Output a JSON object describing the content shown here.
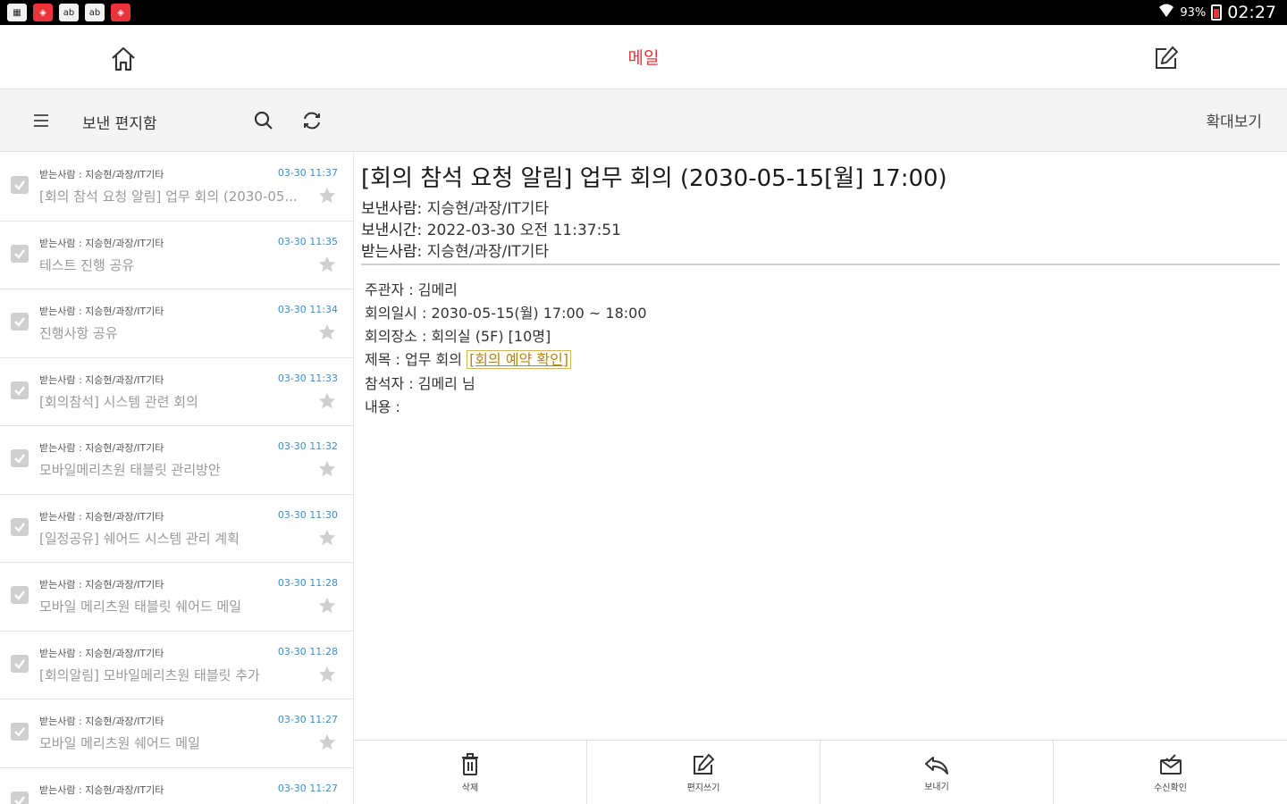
{
  "status_bar": {
    "left_icons": [
      "app-icon",
      "shield-red-icon",
      "ab-icon",
      "ab-icon",
      "shield-red-icon"
    ],
    "battery_percent": "93%",
    "time": "02:27"
  },
  "app_bar": {
    "title": "메일"
  },
  "toolbar": {
    "folder_name": "보낸 편지함",
    "zoom_label": "확대보기"
  },
  "mail_list": [
    {
      "sender": "받는사람 : 지승현/과장/IT기타",
      "date": "03-30 11:37",
      "subject": "[회의 참석 요청 알림] 업무 회의 (2030-05..."
    },
    {
      "sender": "받는사람 : 지승현/과장/IT기타",
      "date": "03-30 11:35",
      "subject": "테스트 진행 공유"
    },
    {
      "sender": "받는사람 : 지승현/과장/IT기타",
      "date": "03-30 11:34",
      "subject": "진행사항 공유"
    },
    {
      "sender": "받는사람 : 지승현/과장/IT기타",
      "date": "03-30 11:33",
      "subject": "[회의참석] 시스템 관련 회의"
    },
    {
      "sender": "받는사람 : 지승현/과장/IT기타",
      "date": "03-30 11:32",
      "subject": "모바일메리츠원 태블릿 관리방안"
    },
    {
      "sender": "받는사람 : 지승현/과장/IT기타",
      "date": "03-30 11:30",
      "subject": "[일정공유] 쉐어드 시스템 관리 계획"
    },
    {
      "sender": "받는사람 : 지승현/과장/IT기타",
      "date": "03-30 11:28",
      "subject": "모바일 메리츠원 태블릿 쉐어드 메일"
    },
    {
      "sender": "받는사람 : 지승현/과장/IT기타",
      "date": "03-30 11:28",
      "subject": "[회의알림] 모바일메리츠원 태블릿 추가"
    },
    {
      "sender": "받는사람 : 지승현/과장/IT기타",
      "date": "03-30 11:27",
      "subject": "모바일 메리츠원 쉐어드 메일"
    },
    {
      "sender": "받는사람 : 지승현/과장/IT기타",
      "date": "03-30 11:27",
      "subject": ""
    }
  ],
  "detail": {
    "subject": "[회의 참석 요청 알림] 업무 회의 (2030-05-15[월] 17:00)",
    "sender_label": "보낸사람:",
    "sender": "지승현/과장/IT기타",
    "sent_time_label": "보낸시간:",
    "sent_time": "2022-03-30 오전 11:37:51",
    "recipient_label": "받는사람:",
    "recipient": "지승현/과장/IT기타",
    "body": {
      "organizer": "주관자 : 김메리",
      "datetime": "회의일시 : 2030-05-15(월) 17:00 ~ 18:00",
      "location": "회의장소 : 회의실 (5F) [10명]",
      "title_prefix": "제목 : 업무 회의 ",
      "title_link": "[회의 예약 확인]",
      "attendees": "참석자 : 김메리 님",
      "content": "내용 :"
    }
  },
  "actions": [
    {
      "label": "삭제",
      "icon": "trash-icon"
    },
    {
      "label": "편지쓰기",
      "icon": "compose-icon"
    },
    {
      "label": "보내기",
      "icon": "reply-icon"
    },
    {
      "label": "수신확인",
      "icon": "read-receipt-icon"
    }
  ],
  "colors": {
    "accent": "#e8343a",
    "date": "#3a8fd0",
    "link": "#b8860b"
  }
}
